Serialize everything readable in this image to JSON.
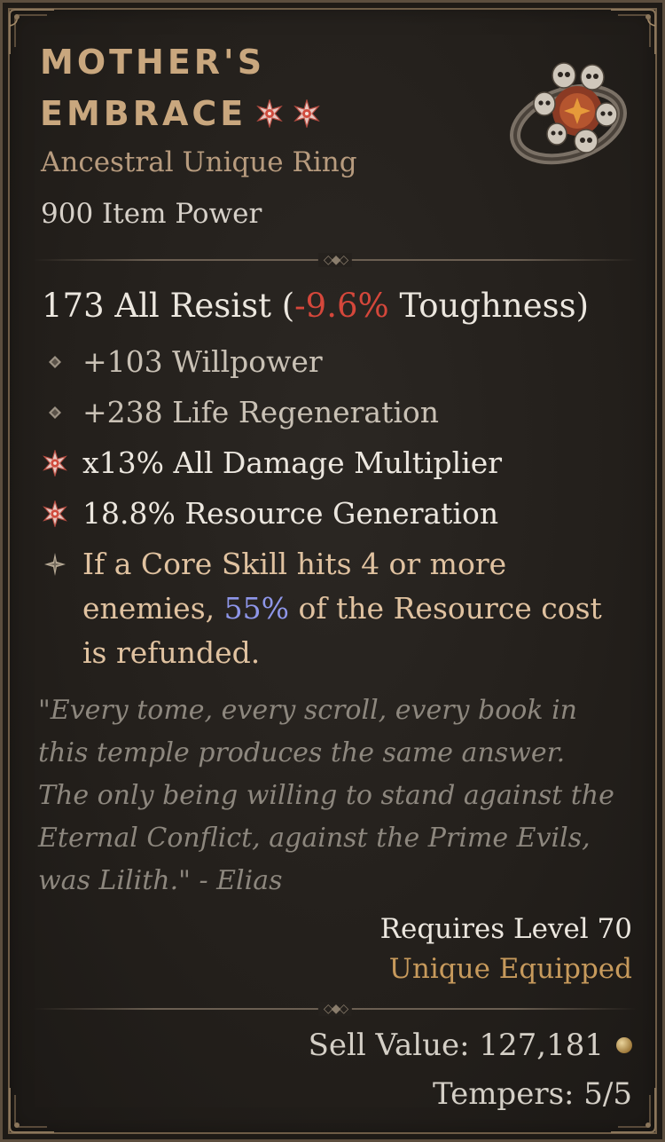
{
  "item": {
    "name_line1": "MOTHER'S",
    "name_line2": "EMBRACE",
    "type": "Ancestral Unique Ring",
    "item_power": "900 Item Power",
    "icon": "skull-ring-icon"
  },
  "stats": {
    "resist_prefix": "173 All Resist (",
    "resist_toughness": "-9.6%",
    "resist_suffix": " Toughness)"
  },
  "affixes": [
    {
      "icon": "diamond-bullet-icon",
      "text": "+103 Willpower"
    },
    {
      "icon": "diamond-bullet-icon",
      "text": "+238 Life Regeneration"
    },
    {
      "icon": "greater-affix-star-icon",
      "text": "x13% All Damage Multiplier"
    },
    {
      "icon": "greater-affix-star-icon",
      "text": "18.8% Resource Generation"
    }
  ],
  "legendary": {
    "icon": "legendary-star-icon",
    "part1": "If a Core Skill hits 4 or more enemies, ",
    "value": "55%",
    "part2": " of the Resource cost is refunded."
  },
  "flavor": "\"Every tome, every scroll, every book in this temple produces the same answer. The only being willing to stand against the Eternal Conflict, against the Prime Evils, was Lilith.\" - Elias",
  "requirements": {
    "level": "Requires Level 70",
    "equipped": "Unique Equipped"
  },
  "footer": {
    "sell_value": "Sell Value: 127,181",
    "tempers": "Tempers: 5/5"
  },
  "colors": {
    "title": "#c9a77e",
    "negative": "#d5473b",
    "highlight": "#8e96e9",
    "legendary_text": "#e0c2a0",
    "unique": "#c79a5c"
  }
}
